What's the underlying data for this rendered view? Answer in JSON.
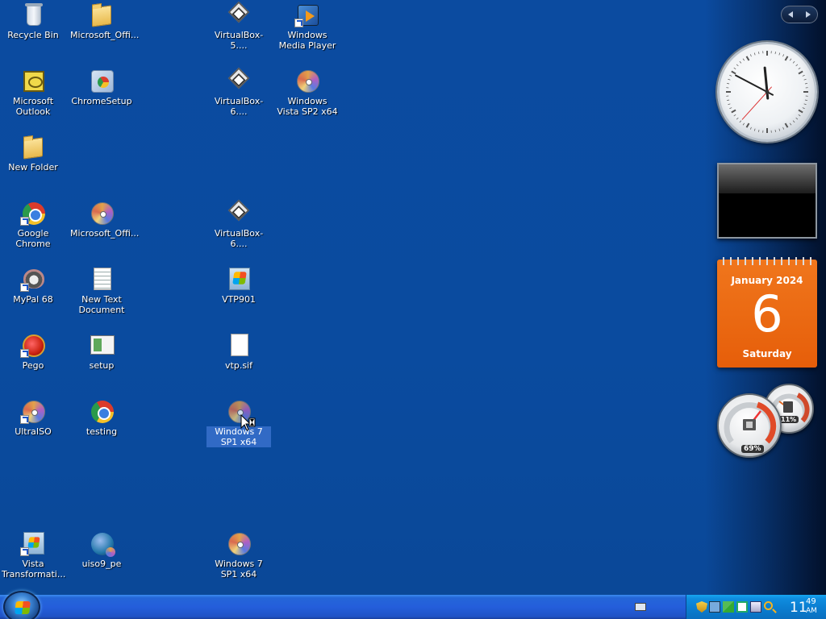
{
  "desktop_icons": [
    {
      "label": "Recycle Bin",
      "icon": "recycle-bin-icon",
      "shortcut": false
    },
    {
      "label": "Microsoft_Offi...",
      "icon": "folder-icon",
      "shortcut": false
    },
    {
      "label": "VirtualBox-5....",
      "icon": "virtualbox-icon",
      "shortcut": false
    },
    {
      "label": "Windows Media Player",
      "icon": "windows-media-player-icon",
      "shortcut": true
    },
    {
      "label": "Microsoft Outlook",
      "icon": "outlook-icon",
      "shortcut": false
    },
    {
      "label": "ChromeSetup",
      "icon": "chrome-setup-icon",
      "shortcut": false
    },
    {
      "label": "VirtualBox-6....",
      "icon": "virtualbox-icon",
      "shortcut": false
    },
    {
      "label": "Windows Vista SP2 x64",
      "icon": "disc-image-icon",
      "shortcut": false
    },
    {
      "label": "New Folder",
      "icon": "folder-icon",
      "shortcut": false
    },
    {
      "label": "Google Chrome",
      "icon": "chrome-icon",
      "shortcut": true
    },
    {
      "label": "Microsoft_Offi...",
      "icon": "disc-image-icon",
      "shortcut": false
    },
    {
      "label": "VirtualBox-6....",
      "icon": "virtualbox-icon",
      "shortcut": false
    },
    {
      "label": "MyPal 68",
      "icon": "mypal-icon",
      "shortcut": true
    },
    {
      "label": "New Text Document",
      "icon": "text-document-icon",
      "shortcut": false
    },
    {
      "label": "VTP901",
      "icon": "windows-installer-icon",
      "shortcut": false
    },
    {
      "label": "Pego",
      "icon": "pego-icon",
      "shortcut": true
    },
    {
      "label": "setup",
      "icon": "setup-icon",
      "shortcut": false
    },
    {
      "label": "vtp.sif",
      "icon": "file-icon",
      "shortcut": false
    },
    {
      "label": "UltraISO",
      "icon": "ultraiso-icon",
      "shortcut": true
    },
    {
      "label": "testing",
      "icon": "chrome-icon",
      "shortcut": false
    },
    {
      "label": "Windows 7 SP1 x64",
      "icon": "disc-image-icon",
      "shortcut": false,
      "selected": true
    },
    {
      "label": "Vista Transformati...",
      "icon": "vista-transformation-icon",
      "shortcut": true
    },
    {
      "label": "uiso9_pe",
      "icon": "uiso-globe-icon",
      "shortcut": false
    },
    {
      "label": "Windows 7 SP1 x64",
      "icon": "disc-image-icon",
      "shortcut": false
    }
  ],
  "sidebar": {
    "calendar": {
      "month_year": "January 2024",
      "day": "6",
      "weekday": "Saturday"
    },
    "cpu_meter": {
      "cpu_percent": "69%",
      "memory_percent": "11%"
    },
    "clock": {
      "hour": 11,
      "minute": 49,
      "second": 37
    }
  },
  "taskbar": {
    "clock_hour": "11",
    "clock_minute": "49",
    "clock_ampm": "AM",
    "tray_icons": [
      "security-shield-icon",
      "network-icon",
      "security-center-icon",
      "monitor-icon",
      "display-icon",
      "search-icon"
    ]
  },
  "colors": {
    "desktop_background": "#0a4b9f",
    "selection": "#316ac5",
    "calendar_orange": "#e8650f",
    "taskbar_blue": "#245edb",
    "tray_blue": "#0b7fd2"
  }
}
